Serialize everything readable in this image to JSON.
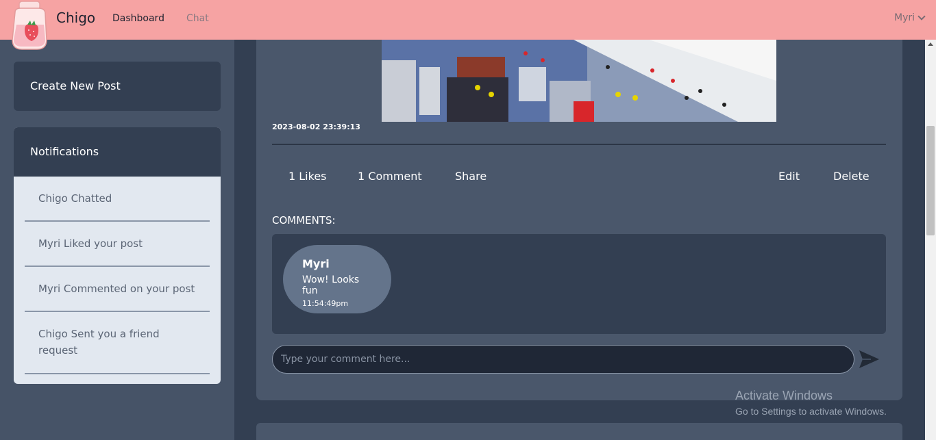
{
  "nav": {
    "brand": "Chigo",
    "links": [
      "Dashboard",
      "Chat"
    ],
    "user": "Myri"
  },
  "sidebar": {
    "create_post": "Create New Post",
    "notifications_title": "Notifications",
    "notifications": [
      "Chigo Chatted",
      "Myri Liked your post",
      "Myri Commented on your post",
      "Chigo Sent you a friend request"
    ]
  },
  "post": {
    "timestamp": "2023-08-02 23:39:13",
    "actions": {
      "likes": "1 Likes",
      "comments": "1 Comment",
      "share": "Share",
      "edit": "Edit",
      "delete": "Delete"
    },
    "comments_label": "COMMENTS:",
    "comment": {
      "author": "Myri",
      "text": "Wow! Looks fun",
      "time": "11:54:49pm"
    },
    "input_placeholder": "Type your comment here..."
  },
  "watermark": {
    "title": "Activate Windows",
    "subtitle": "Go to Settings to activate Windows."
  },
  "colors": {
    "navbar": "#f6a3a3",
    "sidebar": "#465367",
    "card": "#4a576b",
    "dark": "#333f52"
  }
}
